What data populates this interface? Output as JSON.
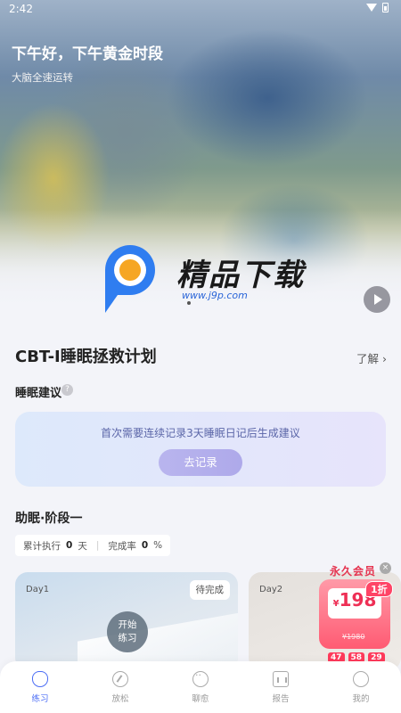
{
  "status_bar": {
    "time": "2:42"
  },
  "hero": {
    "greeting": "下午好，下午黄金时段",
    "subtitle": "大脑全速运转",
    "watermark_title": "精品下载",
    "watermark_url": "www.j9p.com"
  },
  "plan": {
    "title": "CBT-I睡眠拯救计划",
    "more_label": "了解 ›"
  },
  "sleep_advice": {
    "label": "睡眠建议",
    "help_icon": "?",
    "message": "首次需要连续记录3天睡眠日记后生成建议",
    "button_label": "去记录"
  },
  "stage": {
    "title": "助眠·阶段一",
    "cumulative_label": "累计执行",
    "cumulative_value": "0",
    "cumulative_unit": "天",
    "completion_label": "完成率",
    "completion_value": "0",
    "completion_unit": "%"
  },
  "days": [
    {
      "label": "Day1",
      "badge": "待完成",
      "start_label_1": "开始",
      "start_label_2": "练习"
    },
    {
      "label": "Day2"
    }
  ],
  "promo": {
    "title": "永久会员",
    "close": "×",
    "currency": "¥",
    "price": "198",
    "old_price": "¥1980",
    "discount": "1折",
    "timer": [
      "47",
      "58",
      "29"
    ]
  },
  "nav": [
    {
      "label": "练习",
      "icon": "practice-icon",
      "active": true
    },
    {
      "label": "放松",
      "icon": "compass-icon",
      "active": false
    },
    {
      "label": "聊愈",
      "icon": "chat-icon",
      "active": false
    },
    {
      "label": "报告",
      "icon": "report-icon",
      "active": false
    },
    {
      "label": "我的",
      "icon": "profile-icon",
      "active": false
    }
  ],
  "colors": {
    "accent": "#4b6df5",
    "promo_red": "#ee2f55",
    "advice_text": "#5b66a8"
  }
}
